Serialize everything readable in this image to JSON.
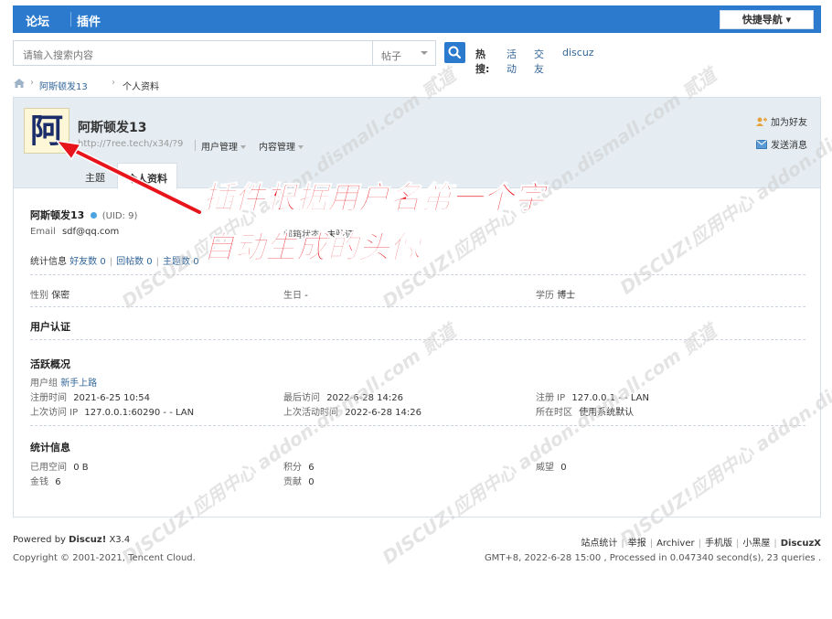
{
  "topnav": {
    "forum": "论坛",
    "plugin": "插件",
    "quicknav": "快捷导航 ▾"
  },
  "search": {
    "placeholder": "请输入搜索内容",
    "type": "帖子",
    "hot_label": "热搜:",
    "hot_items": [
      "活动",
      "交友",
      "discuz"
    ]
  },
  "breadcrumb": {
    "user": "阿斯顿发13",
    "page": "个人资料"
  },
  "profile": {
    "avatar_char": "阿",
    "name": "阿斯顿发13",
    "url": "http://7ree.tech/x34/?9",
    "menu": [
      "用户管理",
      "内容管理"
    ],
    "actions": {
      "add_friend": "加为好友",
      "send_msg": "发送消息"
    },
    "tabs": [
      "主题",
      "个人资料"
    ]
  },
  "details": {
    "user_line": "阿斯顿发13",
    "uid": "(UID: 9)",
    "email_label": "Email",
    "email": "sdf@qq.com",
    "email_status_label": "邮箱状态",
    "email_status": "未验证",
    "stats_line": {
      "label": "统计信息",
      "friends": "好友数 0",
      "replies": "回帖数 0",
      "topics": "主题数 0"
    },
    "gender_label": "性别",
    "gender": "保密",
    "birthday_label": "生日",
    "birthday": "-",
    "edu_label": "学历",
    "edu": "博士",
    "cert_title": "用户认证",
    "activity_title": "活跃概况",
    "group_label": "用户组",
    "group": "新手上路",
    "reg_time_label": "注册时间",
    "reg_time": "2021-6-25 10:54",
    "last_visit_label": "最后访问",
    "last_visit": "2022-6-28 14:26",
    "reg_ip_label": "注册 IP",
    "reg_ip": "127.0.0.1 - - LAN",
    "last_ip_label": "上次访问 IP",
    "last_ip": "127.0.0.1:60290 - - LAN",
    "last_active_label": "上次活动时间",
    "last_active": "2022-6-28 14:26",
    "tz_label": "所在时区",
    "tz": "使用系统默认",
    "stats_title": "统计信息",
    "space_label": "已用空间",
    "space": "0 B",
    "points_label": "积分",
    "points": "6",
    "prestige_label": "威望",
    "prestige": "0",
    "money_label": "金钱",
    "money": "6",
    "contrib_label": "贡献",
    "contrib": "0"
  },
  "annotation": {
    "line1": "插件根据用户名第一个字",
    "line2": "自动生成的头像"
  },
  "footer": {
    "powered": "Powered by",
    "brand": "Discuz!",
    "version": "X3.4",
    "copyright": "Copyright © 2001-2021, Tencent Cloud.",
    "links": [
      "站点统计",
      "举报",
      "Archiver",
      "手机版",
      "小黑屋"
    ],
    "brand_right": "DiscuzX",
    "status": "GMT+8, 2022-6-28 15:00 , Processed in 0.047340 second(s), 23 queries ."
  },
  "watermark": "DISCUZ!应用中心 addon.dismall.com 贰道"
}
